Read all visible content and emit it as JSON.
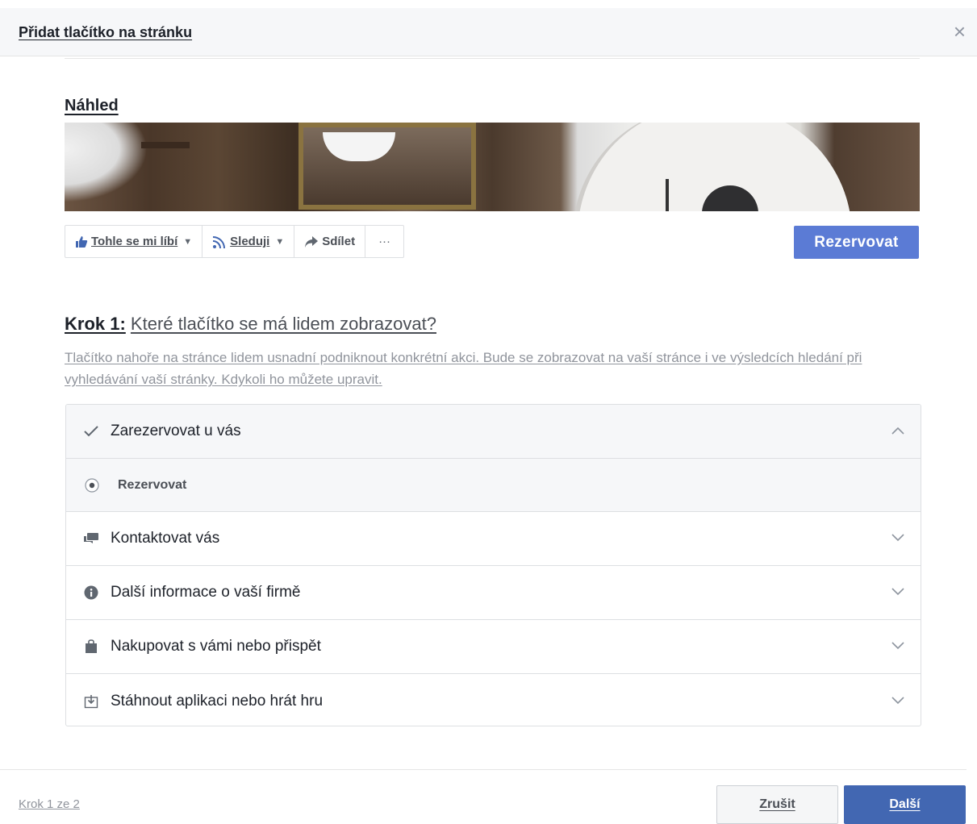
{
  "dialog": {
    "title": "Přidat tlačítko na stránku"
  },
  "preview": {
    "label": "Náhled",
    "actions": [
      {
        "label": "Tohle se mi líbí",
        "icon": "thumbs-up-icon"
      },
      {
        "label": "Sleduji",
        "icon": "rss-icon"
      },
      {
        "label": "Sdílet",
        "icon": "share-arrow-icon"
      },
      {
        "label": "···",
        "icon": "more-icon"
      }
    ],
    "cta_label": "Rezervovat"
  },
  "step": {
    "prefix": "Krok 1:",
    "question": "Které tlačítko se má lidem zobrazovat?",
    "description": "Tlačítko nahoře na stránce lidem usnadní podniknout konkrétní akci. Bude se zobrazovat na vaší stránce i ve výsledcích hledání při vyhledávání vaší stránky. Kdykoli ho můžete upravit."
  },
  "options": {
    "book": {
      "label": "Zarezervovat u vás",
      "icon": "check-icon",
      "expanded": true
    },
    "book_sub": {
      "label": "Rezervovat",
      "icon": "radio-selected-icon"
    },
    "contact": {
      "label": "Kontaktovat vás",
      "icon": "chat-bubbles-icon"
    },
    "info": {
      "label": "Další informace o vaší firmě",
      "icon": "info-icon"
    },
    "shop": {
      "label": "Nakupovat s vámi nebo přispět",
      "icon": "shopping-bag-icon"
    },
    "app": {
      "label": "Stáhnout aplikaci nebo hrát hru",
      "icon": "download-icon"
    }
  },
  "footer": {
    "step_counter": "Krok 1 ze 2",
    "cancel_label": "Zrušit",
    "next_label": "Další"
  },
  "colors": {
    "cta": "#5b7bd5",
    "primary": "#4267b2",
    "muted_text": "#90949c",
    "border": "#dddfe2"
  }
}
